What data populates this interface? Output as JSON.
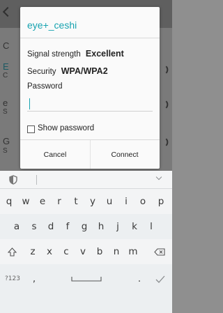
{
  "background": {
    "peek_letters": [
      "C",
      "E",
      "C",
      "e",
      "S",
      "G",
      "S"
    ]
  },
  "dialog": {
    "network_name": "eye+_ceshi",
    "signal_label": "Signal strength",
    "signal_value": "Excellent",
    "security_label": "Security",
    "security_value": "WPA/WPA2",
    "password_label": "Password",
    "password_value": "",
    "show_password_label": "Show password",
    "show_password_checked": false,
    "cancel_label": "Cancel",
    "connect_label": "Connect",
    "accent_color": "#17a3b0"
  },
  "keyboard": {
    "row1": [
      "q",
      "w",
      "e",
      "r",
      "t",
      "y",
      "u",
      "i",
      "o",
      "p"
    ],
    "row2": [
      "a",
      "s",
      "d",
      "f",
      "g",
      "h",
      "j",
      "k",
      "l"
    ],
    "row3": [
      "z",
      "x",
      "c",
      "v",
      "b",
      "n",
      "m"
    ],
    "symbols_label": "?123",
    "comma_label": ",",
    "period_label": ".",
    "icons": [
      "shield-icon",
      "collapse-chevron-icon",
      "shift-icon",
      "backspace-icon",
      "space-icon",
      "enter-check-icon"
    ]
  }
}
